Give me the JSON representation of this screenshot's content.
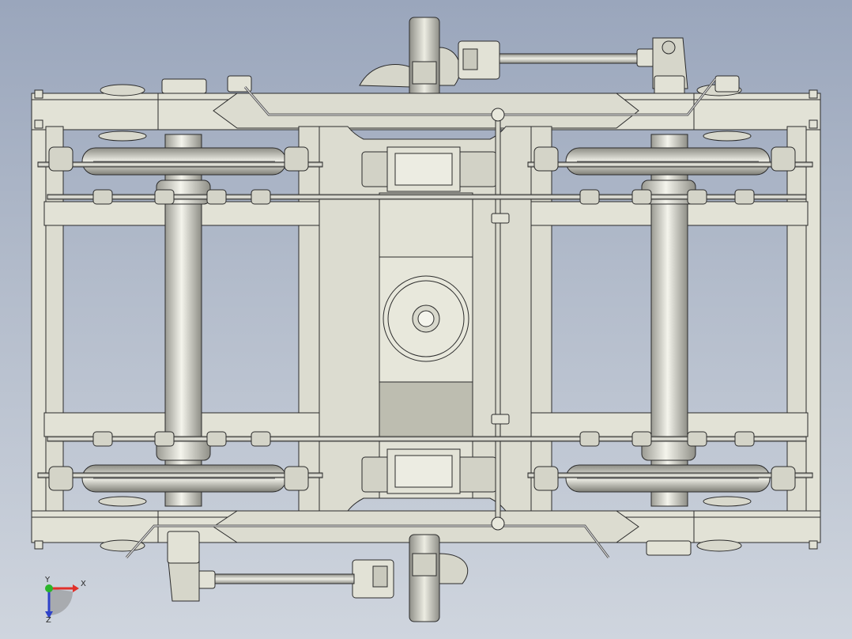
{
  "viewport": {
    "background_top": "#9aa6bc",
    "background_bottom": "#cfd5de",
    "part_fill": "#e2e2d6",
    "part_fill_dark": "#bdbdb0",
    "part_stroke": "#2b2b2b"
  },
  "triad": {
    "x_label": "X",
    "y_label": "Y",
    "z_label": "Z",
    "x_color": "#e0302a",
    "y_color": "#2bb52b",
    "z_color": "#2f43c9"
  }
}
